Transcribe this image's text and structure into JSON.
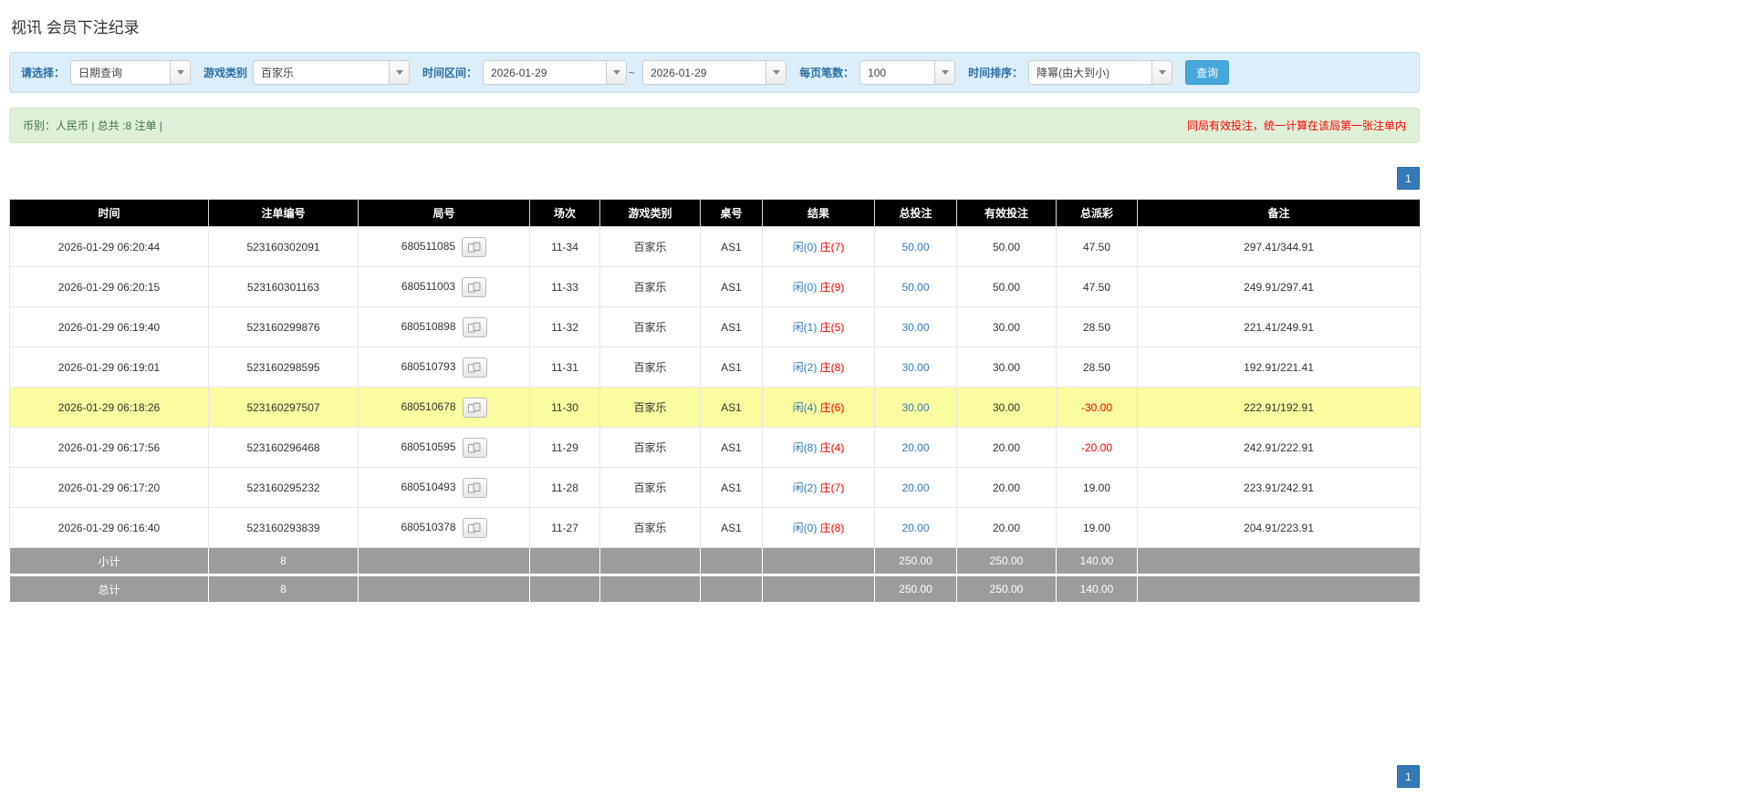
{
  "page": {
    "title": "视讯 会员下注纪录"
  },
  "filters": {
    "select_label": "请选择：",
    "select_value": "日期查询",
    "game_label": "游戏类别",
    "game_value": "百家乐",
    "range_label": "时间区间：",
    "date_from": "2026-01-29",
    "range_separator": "~",
    "date_to": "2026-01-29",
    "page_size_label": "每页笔数：",
    "page_size_value": "100",
    "sort_label": "时间排序：",
    "sort_value": "降幂(由大到小)",
    "search_label": "查询"
  },
  "summary_bar": {
    "currency_info": "币别：人民币 | 总共 :8 注单 |",
    "notice": "同局有效投注，统一计算在该局第一张注单内"
  },
  "pagination": {
    "top": "1",
    "bottom": "1"
  },
  "colors": {
    "accent_blue": "#337ab7",
    "negative_red": "#ff0000",
    "highlight_yellow": "#fbfba0",
    "header_black": "#000000",
    "filter_bg": "#dbeef9",
    "summary_bg": "#dff0d8",
    "footer_gray": "#9c9c9c"
  },
  "table": {
    "headers": [
      "时间",
      "注单编号",
      "局号",
      "场次",
      "游戏类别",
      "桌号",
      "结果",
      "总投注",
      "有效投注",
      "总派彩",
      "备注"
    ],
    "rows": [
      {
        "time": "2026-01-29 06:20:44",
        "bet_id": "523160302091",
        "round_id": "680511085",
        "session": "11-34",
        "game": "百家乐",
        "table_no": "AS1",
        "result_player": "闲(0)",
        "result_banker": "庄(7)",
        "total_bet": "50.00",
        "valid_bet": "50.00",
        "payout": "47.50",
        "payout_negative": false,
        "note": "297.41/344.91",
        "highlight": false
      },
      {
        "time": "2026-01-29 06:20:15",
        "bet_id": "523160301163",
        "round_id": "680511003",
        "session": "11-33",
        "game": "百家乐",
        "table_no": "AS1",
        "result_player": "闲(0)",
        "result_banker": "庄(9)",
        "total_bet": "50.00",
        "valid_bet": "50.00",
        "payout": "47.50",
        "payout_negative": false,
        "note": "249.91/297.41",
        "highlight": false
      },
      {
        "time": "2026-01-29 06:19:40",
        "bet_id": "523160299876",
        "round_id": "680510898",
        "session": "11-32",
        "game": "百家乐",
        "table_no": "AS1",
        "result_player": "闲(1)",
        "result_banker": "庄(5)",
        "total_bet": "30.00",
        "valid_bet": "30.00",
        "payout": "28.50",
        "payout_negative": false,
        "note": "221.41/249.91",
        "highlight": false
      },
      {
        "time": "2026-01-29 06:19:01",
        "bet_id": "523160298595",
        "round_id": "680510793",
        "session": "11-31",
        "game": "百家乐",
        "table_no": "AS1",
        "result_player": "闲(2)",
        "result_banker": "庄(8)",
        "total_bet": "30.00",
        "valid_bet": "30.00",
        "payout": "28.50",
        "payout_negative": false,
        "note": "192.91/221.41",
        "highlight": false
      },
      {
        "time": "2026-01-29 06:18:26",
        "bet_id": "523160297507",
        "round_id": "680510678",
        "session": "11-30",
        "game": "百家乐",
        "table_no": "AS1",
        "result_player": "闲(4)",
        "result_banker": "庄(6)",
        "total_bet": "30.00",
        "valid_bet": "30.00",
        "payout": "-30.00",
        "payout_negative": true,
        "note": "222.91/192.91",
        "highlight": true
      },
      {
        "time": "2026-01-29 06:17:56",
        "bet_id": "523160296468",
        "round_id": "680510595",
        "session": "11-29",
        "game": "百家乐",
        "table_no": "AS1",
        "result_player": "闲(8)",
        "result_banker": "庄(4)",
        "total_bet": "20.00",
        "valid_bet": "20.00",
        "payout": "-20.00",
        "payout_negative": true,
        "note": "242.91/222.91",
        "highlight": false
      },
      {
        "time": "2026-01-29 06:17:20",
        "bet_id": "523160295232",
        "round_id": "680510493",
        "session": "11-28",
        "game": "百家乐",
        "table_no": "AS1",
        "result_player": "闲(2)",
        "result_banker": "庄(7)",
        "total_bet": "20.00",
        "valid_bet": "20.00",
        "payout": "19.00",
        "payout_negative": false,
        "note": "223.91/242.91",
        "highlight": false
      },
      {
        "time": "2026-01-29 06:16:40",
        "bet_id": "523160293839",
        "round_id": "680510378",
        "session": "11-27",
        "game": "百家乐",
        "table_no": "AS1",
        "result_player": "闲(0)",
        "result_banker": "庄(8)",
        "total_bet": "20.00",
        "valid_bet": "20.00",
        "payout": "19.00",
        "payout_negative": false,
        "note": "204.91/223.91",
        "highlight": false
      }
    ],
    "footer_rows": [
      {
        "label": "小计",
        "count": "8",
        "total_bet": "250.00",
        "valid_bet": "250.00",
        "payout": "140.00"
      },
      {
        "label": "总计",
        "count": "8",
        "total_bet": "250.00",
        "valid_bet": "250.00",
        "payout": "140.00"
      }
    ]
  }
}
